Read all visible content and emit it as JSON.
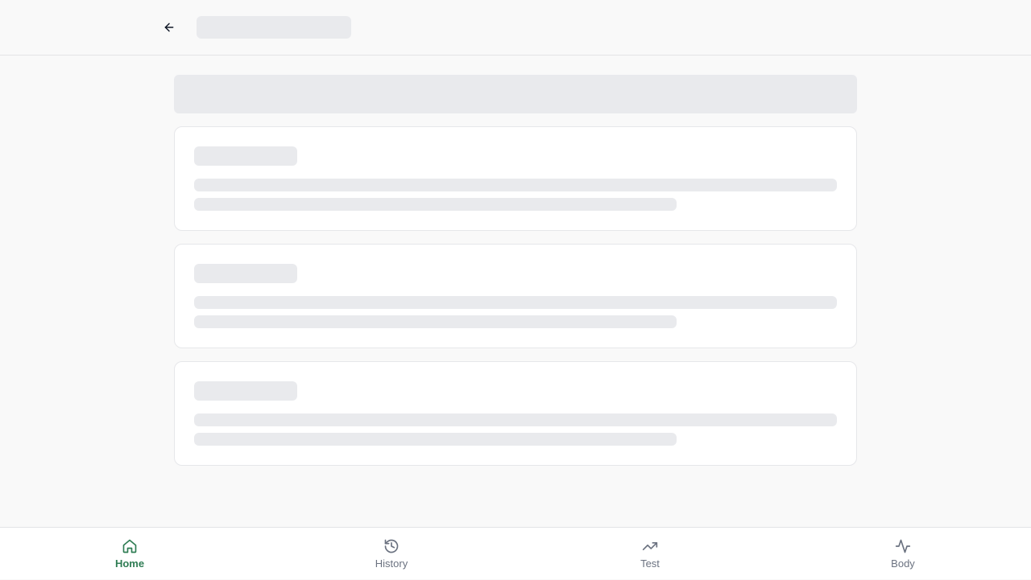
{
  "header": {
    "back_icon": "arrow-left-icon"
  },
  "nav": {
    "items": [
      {
        "label": "Home",
        "icon": "home-icon",
        "active": true
      },
      {
        "label": "History",
        "icon": "history-icon",
        "active": false
      },
      {
        "label": "Test",
        "icon": "trending-up-icon",
        "active": false
      },
      {
        "label": "Body",
        "icon": "activity-icon",
        "active": false
      }
    ]
  },
  "colors": {
    "accent": "#2f7d54",
    "inactive": "#6b7280",
    "skeleton": "#e9eaed"
  }
}
